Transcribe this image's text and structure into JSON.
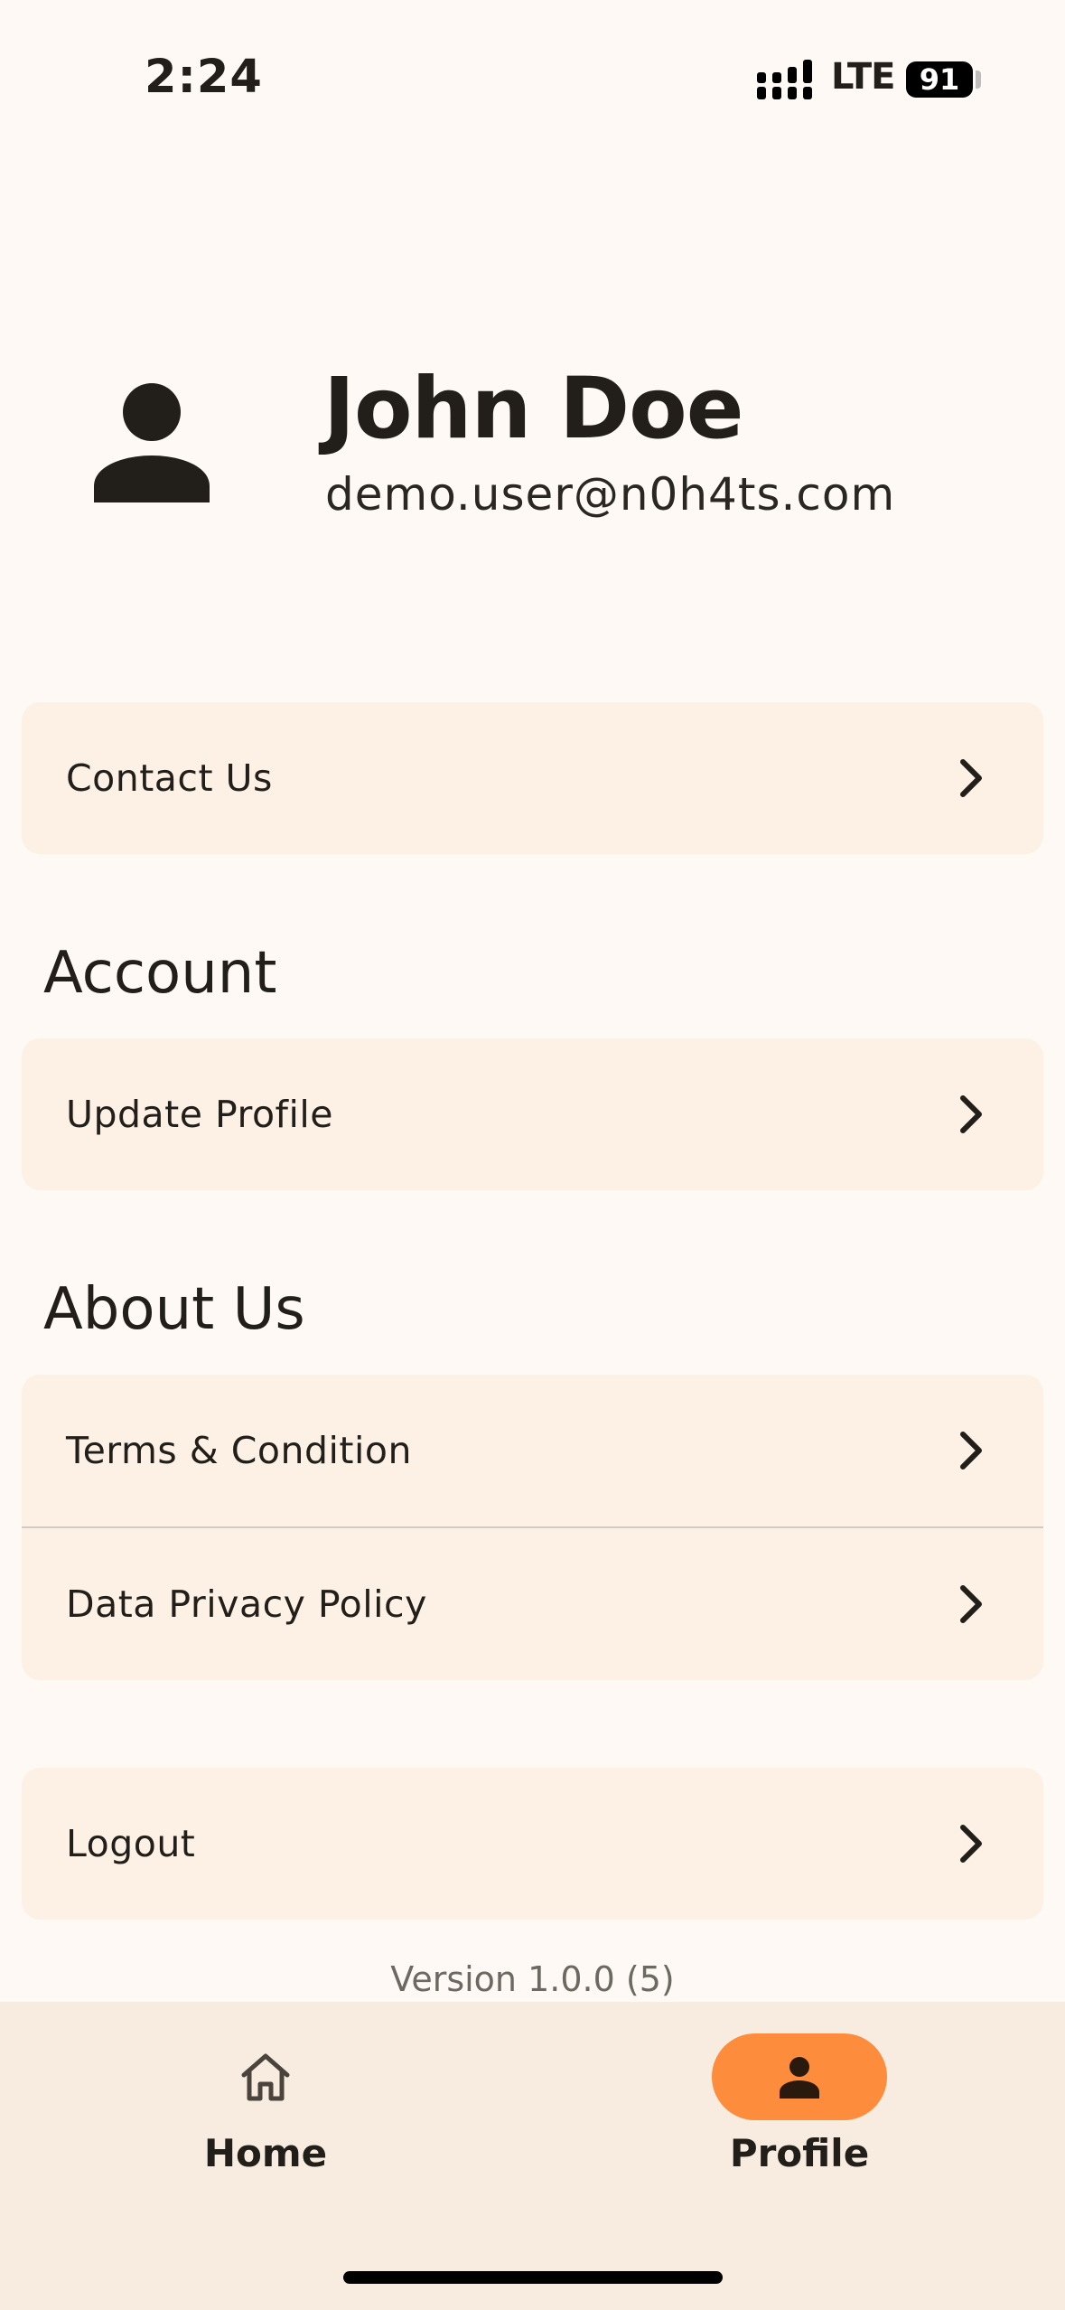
{
  "status_bar": {
    "time": "2:24",
    "network": "LTE",
    "battery": "91"
  },
  "profile": {
    "name": "John Doe",
    "email": "demo.user@n0h4ts.com"
  },
  "menu": {
    "contact_us": "Contact Us",
    "account_title": "Account",
    "update_profile": "Update Profile",
    "about_title": "About Us",
    "terms": "Terms & Condition",
    "privacy": "Data Privacy Policy",
    "logout": "Logout"
  },
  "version": "Version 1.0.0 (5)",
  "nav": {
    "home": "Home",
    "profile": "Profile"
  },
  "colors": {
    "background": "#FEF9F4",
    "card": "#FDF1E6",
    "accent": "#FD8D3C",
    "nav_background": "#F8ECE0"
  },
  "icons": [
    "signal-icon",
    "battery-icon",
    "person-icon",
    "chevron-right-icon",
    "home-icon"
  ]
}
